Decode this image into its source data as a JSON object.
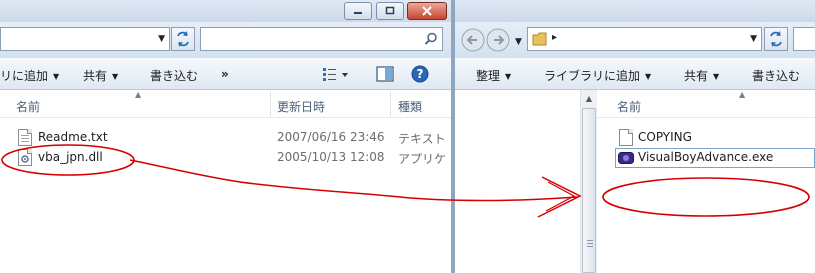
{
  "left_window": {
    "search_placeholder": "",
    "toolbar": {
      "library_label": "リに追加",
      "share_label": "共有",
      "burn_label": "書き込む",
      "more_label": "»"
    },
    "columns": {
      "name": "名前",
      "date_modified": "更新日時",
      "type": "種類"
    },
    "files": [
      {
        "name": "Readme.txt",
        "date": "2007/06/16 23:46",
        "type": "テキスト"
      },
      {
        "name": "vba_jpn.dll",
        "date": "2005/10/13 12:08",
        "type": "アプリケ"
      }
    ]
  },
  "right_window": {
    "toolbar": {
      "organize_label": "整理",
      "library_label": "ライブラリに追加",
      "share_label": "共有",
      "burn_label": "書き込む"
    },
    "columns": {
      "name": "名前"
    },
    "files": [
      {
        "name": "COPYING"
      },
      {
        "name": "VisualBoyAdvance.exe"
      }
    ]
  },
  "colors": {
    "annotation_red": "#d40000",
    "chrome_blue": "#d4e1f0",
    "selection_border": "#7da2ce"
  },
  "icons": [
    "search-icon",
    "refresh-icon",
    "folder-icon",
    "back-icon",
    "forward-icon",
    "view-options-icon",
    "preview-pane-icon",
    "help-icon",
    "text-file-icon",
    "dll-file-icon",
    "exe-file-icon"
  ]
}
